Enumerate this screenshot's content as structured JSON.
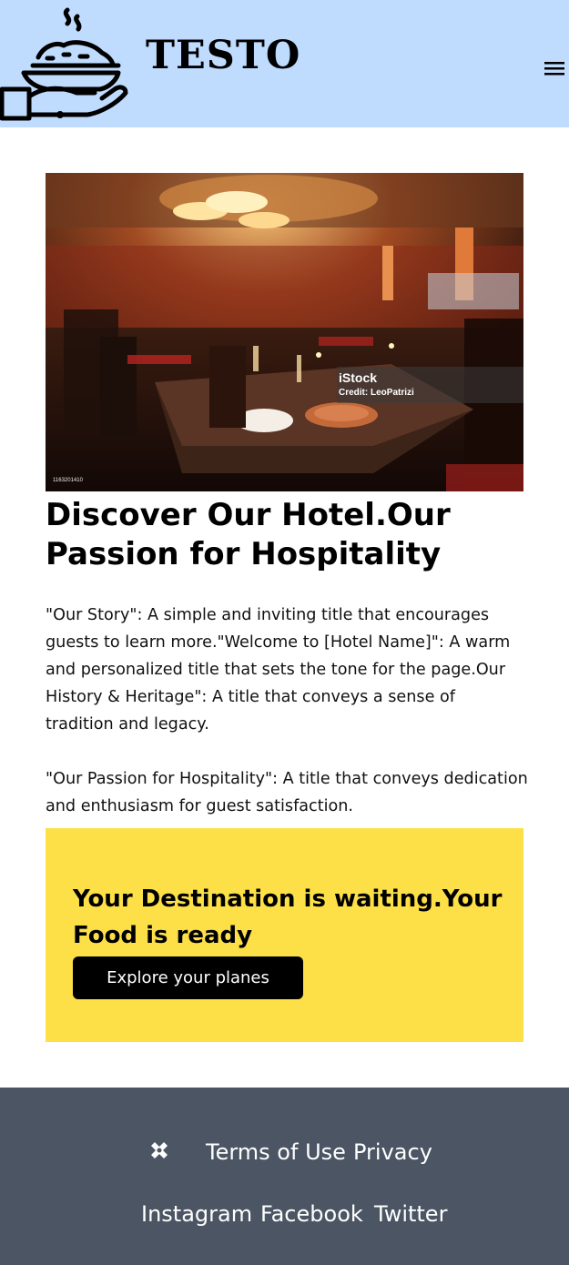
{
  "header": {
    "brand": "TESTO",
    "background": "#bfdbfe"
  },
  "hero": {
    "watermark_brand": "iStock",
    "watermark_credit": "Credit: LeoPatrizi",
    "image_id": "1163201410"
  },
  "content": {
    "title": "Discover Our Hotel.Our Passion for Hospitality",
    "paragraph1": "\"Our Story\": A simple and inviting title that encourages guests to learn more.\"Welcome to [Hotel Name]\": A warm and personalized title that sets the tone for the page.Our History & Heritage\": A title that conveys a sense of tradition and legacy.",
    "paragraph2": "\"Our Passion for Hospitality\": A title that conveys dedication and enthusiasm for guest satisfaction."
  },
  "promo": {
    "title": "Your Destination is waiting.Your Food is ready",
    "button_label": "Explore your planes",
    "background": "#fde047"
  },
  "footer": {
    "links_row1": [
      "Terms of Use",
      "Privacy"
    ],
    "links_row2": [
      "Instagram",
      "Facebook",
      "Twitter"
    ],
    "background": "#4b5563"
  },
  "icons": {
    "logo": "food-tray-hand-icon",
    "menu": "hamburger-menu-icon",
    "footer": "puzzle-x-icon"
  }
}
